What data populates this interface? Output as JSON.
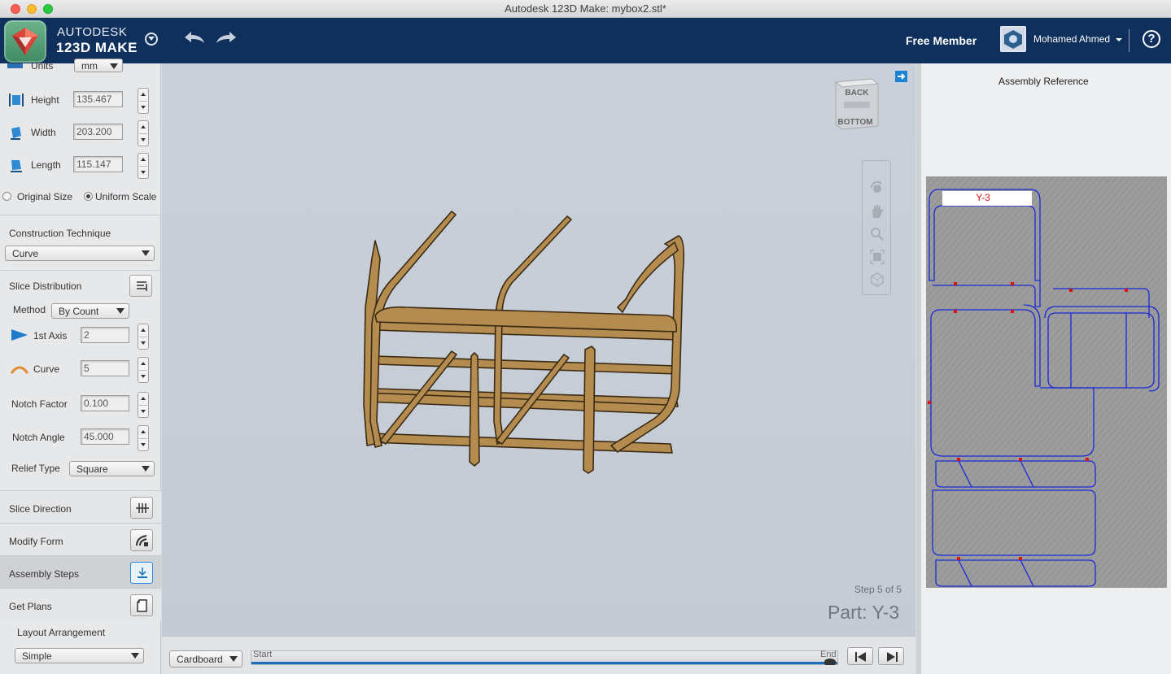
{
  "window": {
    "title": "Autodesk 123D Make: mybox2.stl*"
  },
  "brand": {
    "line1": "AUTODESK",
    "line2": "123D MAKE"
  },
  "account": {
    "membership": "Free Member",
    "user_name": "Mohamed Ahmed",
    "help": "?"
  },
  "colors": {
    "header_bg": "#0f2f5c",
    "accent": "#1b82d2",
    "model": "#b58c4f"
  },
  "sidebar": {
    "units_label": "Units",
    "units_value": "mm",
    "height_label": "Height",
    "height_value": "135.467",
    "width_label": "Width",
    "width_value": "203.200",
    "length_label": "Length",
    "length_value": "115.147",
    "original_size_label": "Original Size",
    "uniform_scale_label": "Uniform Scale",
    "uniform_scale_selected": true,
    "construction_label": "Construction Technique",
    "construction_value": "Curve",
    "slice_distribution_label": "Slice Distribution",
    "method_label": "Method",
    "method_value": "By Count",
    "axis1_label": "1st Axis",
    "axis1_value": "2",
    "curve_label": "Curve",
    "curve_value": "5",
    "notch_factor_label": "Notch Factor",
    "notch_factor_value": "0.100",
    "notch_angle_label": "Notch Angle",
    "notch_angle_value": "45.000",
    "relief_label": "Relief Type",
    "relief_value": "Square",
    "slice_direction_label": "Slice Direction",
    "modify_form_label": "Modify Form",
    "assembly_steps_label": "Assembly Steps",
    "get_plans_label": "Get Plans",
    "layout_label": "Layout Arrangement",
    "layout_value": "Simple"
  },
  "viewport": {
    "step": "Step 5 of 5",
    "part": "Part: Y-3",
    "viewcube_top": "BACK",
    "viewcube_bottom": "BOTTOM",
    "nav_icons": [
      "orbit-icon",
      "pan-icon",
      "zoom-icon",
      "fit-icon",
      "cube-icon"
    ]
  },
  "bottom": {
    "material": "Cardboard",
    "timeline_start": "Start",
    "timeline_end": "End",
    "timeline_progress": 1.0
  },
  "right_panel": {
    "title": "Assembly Reference",
    "sheet_label": "Y-3"
  }
}
